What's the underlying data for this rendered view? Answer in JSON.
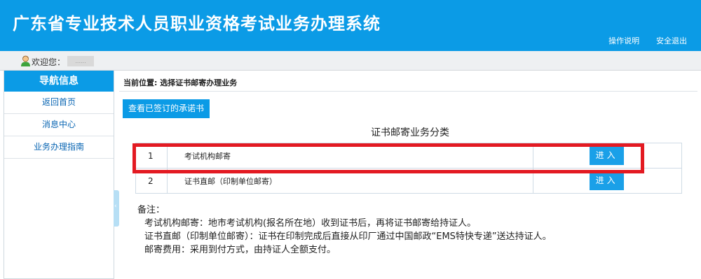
{
  "header": {
    "title": "广东省专业技术人员职业资格考试业务办理系统",
    "help_link": "操作说明",
    "logout_link": "安全退出"
  },
  "welcome": {
    "label": "欢迎您：",
    "username": "......"
  },
  "sidebar": {
    "title": "导航信息",
    "items": [
      {
        "label": "返回首页"
      },
      {
        "label": "消息中心"
      },
      {
        "label": "业务办理指南"
      }
    ]
  },
  "main": {
    "breadcrumb": "当前位置: 选择证书邮寄办理业务",
    "view_button": "查看已签订的承诺书",
    "section_title": "证书邮寄业务分类",
    "rows": [
      {
        "no": "1",
        "name": "考试机构邮寄",
        "action": "进入"
      },
      {
        "no": "2",
        "name": "证书直邮（印制单位邮寄）",
        "action": "进入"
      }
    ],
    "notes": {
      "heading": "备注：",
      "lines": [
        "考试机构邮寄：地市考试机构(报名所在地）收到证书后，再将证书邮寄给持证人。",
        "证书直邮（印制单位邮寄）：证书在印制完成后直接从印厂通过中国邮政“EMS特快专递”送达持证人。",
        "邮寄费用：采用到付方式，由持证人全额支付。"
      ]
    }
  },
  "colors": {
    "primary": "#0b9be6",
    "highlight": "#e31a22"
  }
}
